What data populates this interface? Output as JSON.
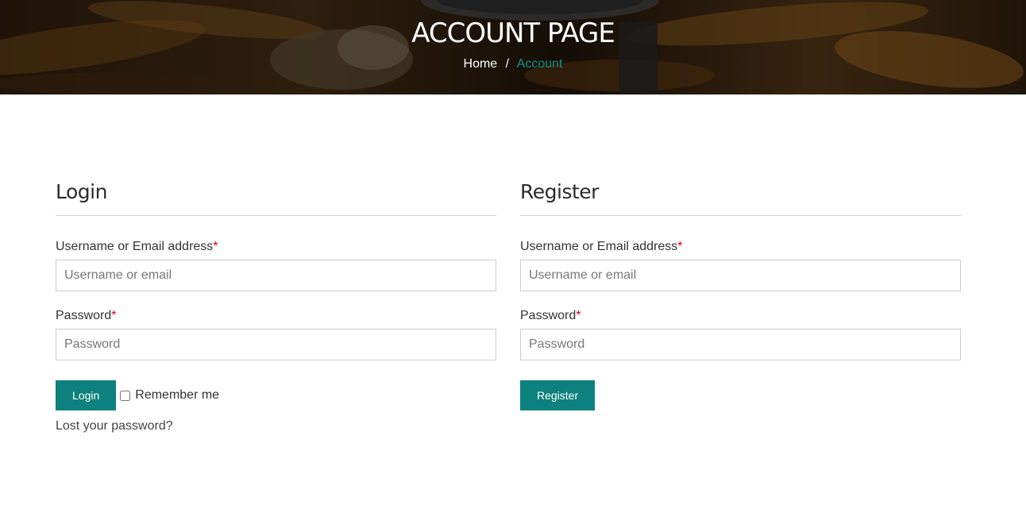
{
  "hero": {
    "title": "ACCOUNT PAGE",
    "breadcrumb": {
      "home": "Home",
      "separator": "/",
      "current": "Account"
    },
    "image": "dark-wood-background-with-wristwatch",
    "accent_color": "#13918a"
  },
  "login": {
    "heading": "Login",
    "username_label": "Username or Email address",
    "username_placeholder": "Username or email",
    "password_label": "Password",
    "password_placeholder": "Password",
    "required_mark": "*",
    "button": "Login",
    "remember_label": "Remember me",
    "remember_checked": false,
    "lost_password": "Lost your password?"
  },
  "register": {
    "heading": "Register",
    "username_label": "Username or Email address",
    "username_placeholder": "Username or email",
    "password_label": "Password",
    "password_placeholder": "Password",
    "required_mark": "*",
    "button": "Register"
  },
  "colors": {
    "button_bg": "#0d817d",
    "required": "#d0021b"
  }
}
